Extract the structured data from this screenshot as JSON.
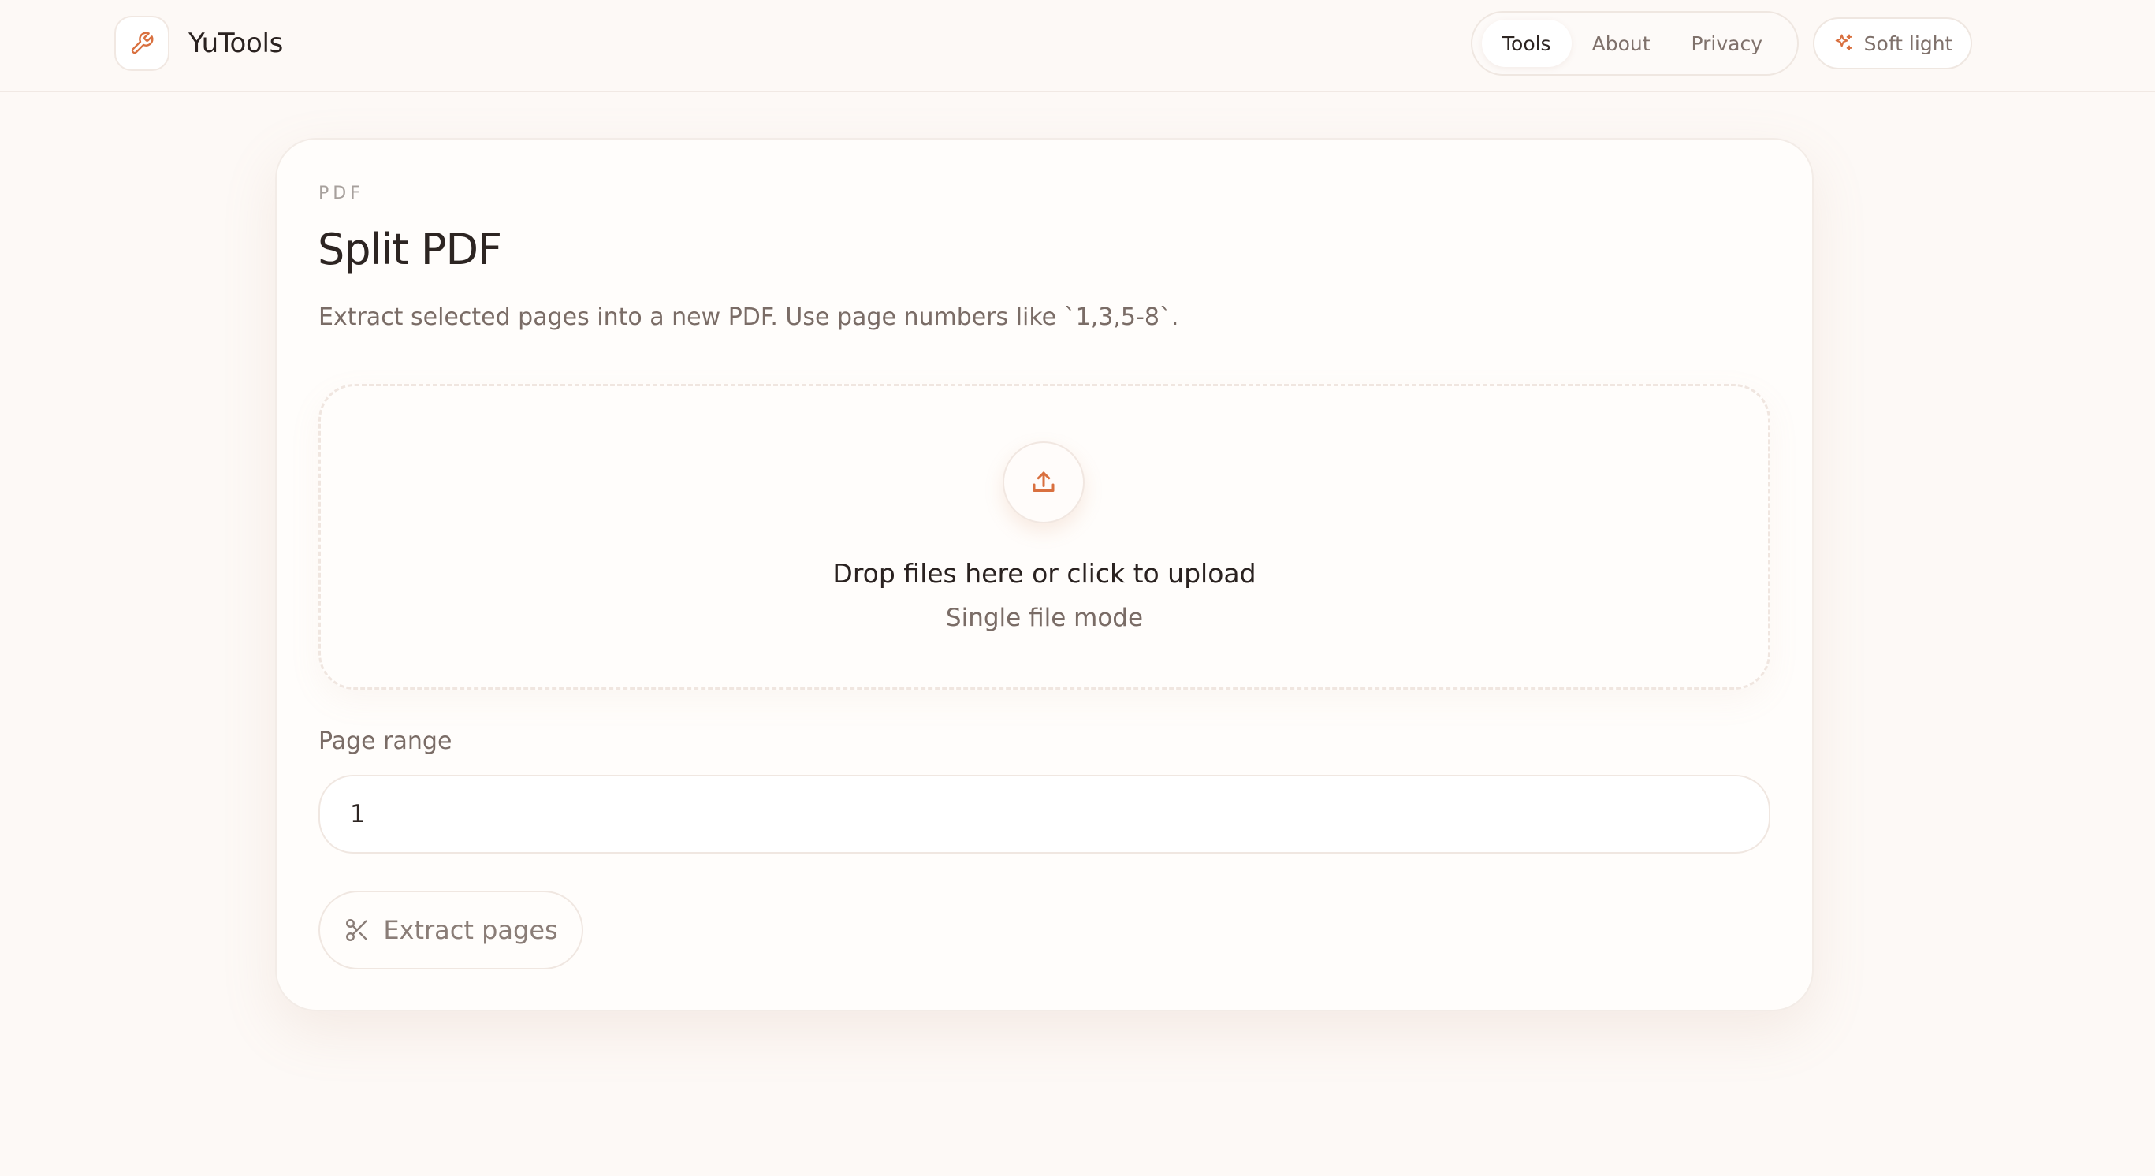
{
  "app": {
    "brand_name": "YuTools",
    "brand_icon": "wrench-icon"
  },
  "nav": {
    "items": [
      {
        "label": "Tools",
        "active": true
      },
      {
        "label": "About",
        "active": false
      },
      {
        "label": "Privacy",
        "active": false
      }
    ]
  },
  "theme": {
    "label": "Soft light",
    "icon": "sparkles-icon"
  },
  "tool": {
    "category": "PDF",
    "title": "Split PDF",
    "description": "Extract selected pages into a new PDF. Use page numbers like `1,3,5-8`."
  },
  "dropzone": {
    "icon": "upload-icon",
    "title": "Drop files here or click to upload",
    "subtitle": "Single file mode"
  },
  "page_range": {
    "label": "Page range",
    "value": "1"
  },
  "action": {
    "label": "Extract pages",
    "icon": "scissors-icon"
  },
  "colors": {
    "accent": "#d9703f",
    "background": "#fdf9f6",
    "text": "#2d2522",
    "muted": "#7a6c66"
  }
}
